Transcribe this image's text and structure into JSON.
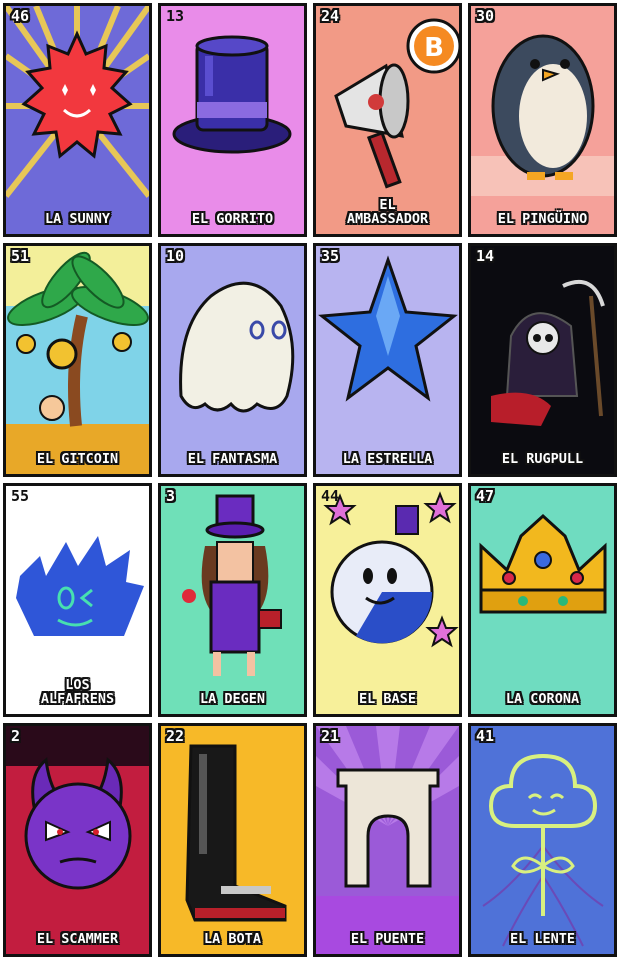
{
  "cards": [
    {
      "number": "46",
      "label": "LA SUNNY",
      "bg": "#6e6ad8",
      "icon": "sun-icon"
    },
    {
      "number": "13",
      "label": "EL GORRITO",
      "bg": "#e98ce9",
      "icon": "top-hat-icon"
    },
    {
      "number": "24",
      "label": "EL\nAMBASSADOR",
      "bg": "#f29a86",
      "icon": "megaphone-icon"
    },
    {
      "number": "30",
      "label": "EL PINGÜINO",
      "bg": "#f5a19a",
      "icon": "penguin-icon"
    },
    {
      "number": "51",
      "label": "EL GITCOIN",
      "bg": "#7fd3e8",
      "icon": "palm-tree-icon"
    },
    {
      "number": "10",
      "label": "EL FANTASMA",
      "bg": "#a8a8ee",
      "icon": "ghost-icon"
    },
    {
      "number": "35",
      "label": "LA ESTRELLA",
      "bg": "#b8b4f0",
      "icon": "star-icon"
    },
    {
      "number": "14",
      "label": "EL RUGPULL",
      "bg": "#0b0b10",
      "icon": "reaper-icon"
    },
    {
      "number": "55",
      "label": "LOS\nALFAFRENS",
      "bg": "#ffffff",
      "icon": "spiky-face-icon"
    },
    {
      "number": "3",
      "label": "LA DEGEN",
      "bg": "#6fe0b8",
      "icon": "degen-character-icon"
    },
    {
      "number": "44",
      "label": "EL BASE",
      "bg": "#f7f09a",
      "icon": "base-orb-icon"
    },
    {
      "number": "47",
      "label": "LA CORONA",
      "bg": "#6fdcc0",
      "icon": "crown-icon"
    },
    {
      "number": "2",
      "label": "EL SCAMMER",
      "bg": "#c21d3f",
      "icon": "devil-face-icon"
    },
    {
      "number": "22",
      "label": "LA BOTA",
      "bg": "#f7b928",
      "icon": "boot-icon"
    },
    {
      "number": "21",
      "label": "EL PUENTE",
      "bg": "#9b5ad8",
      "icon": "arch-bridge-icon"
    },
    {
      "number": "41",
      "label": "EL LENTE",
      "bg": "#4f72d8",
      "icon": "lens-flower-icon"
    }
  ]
}
